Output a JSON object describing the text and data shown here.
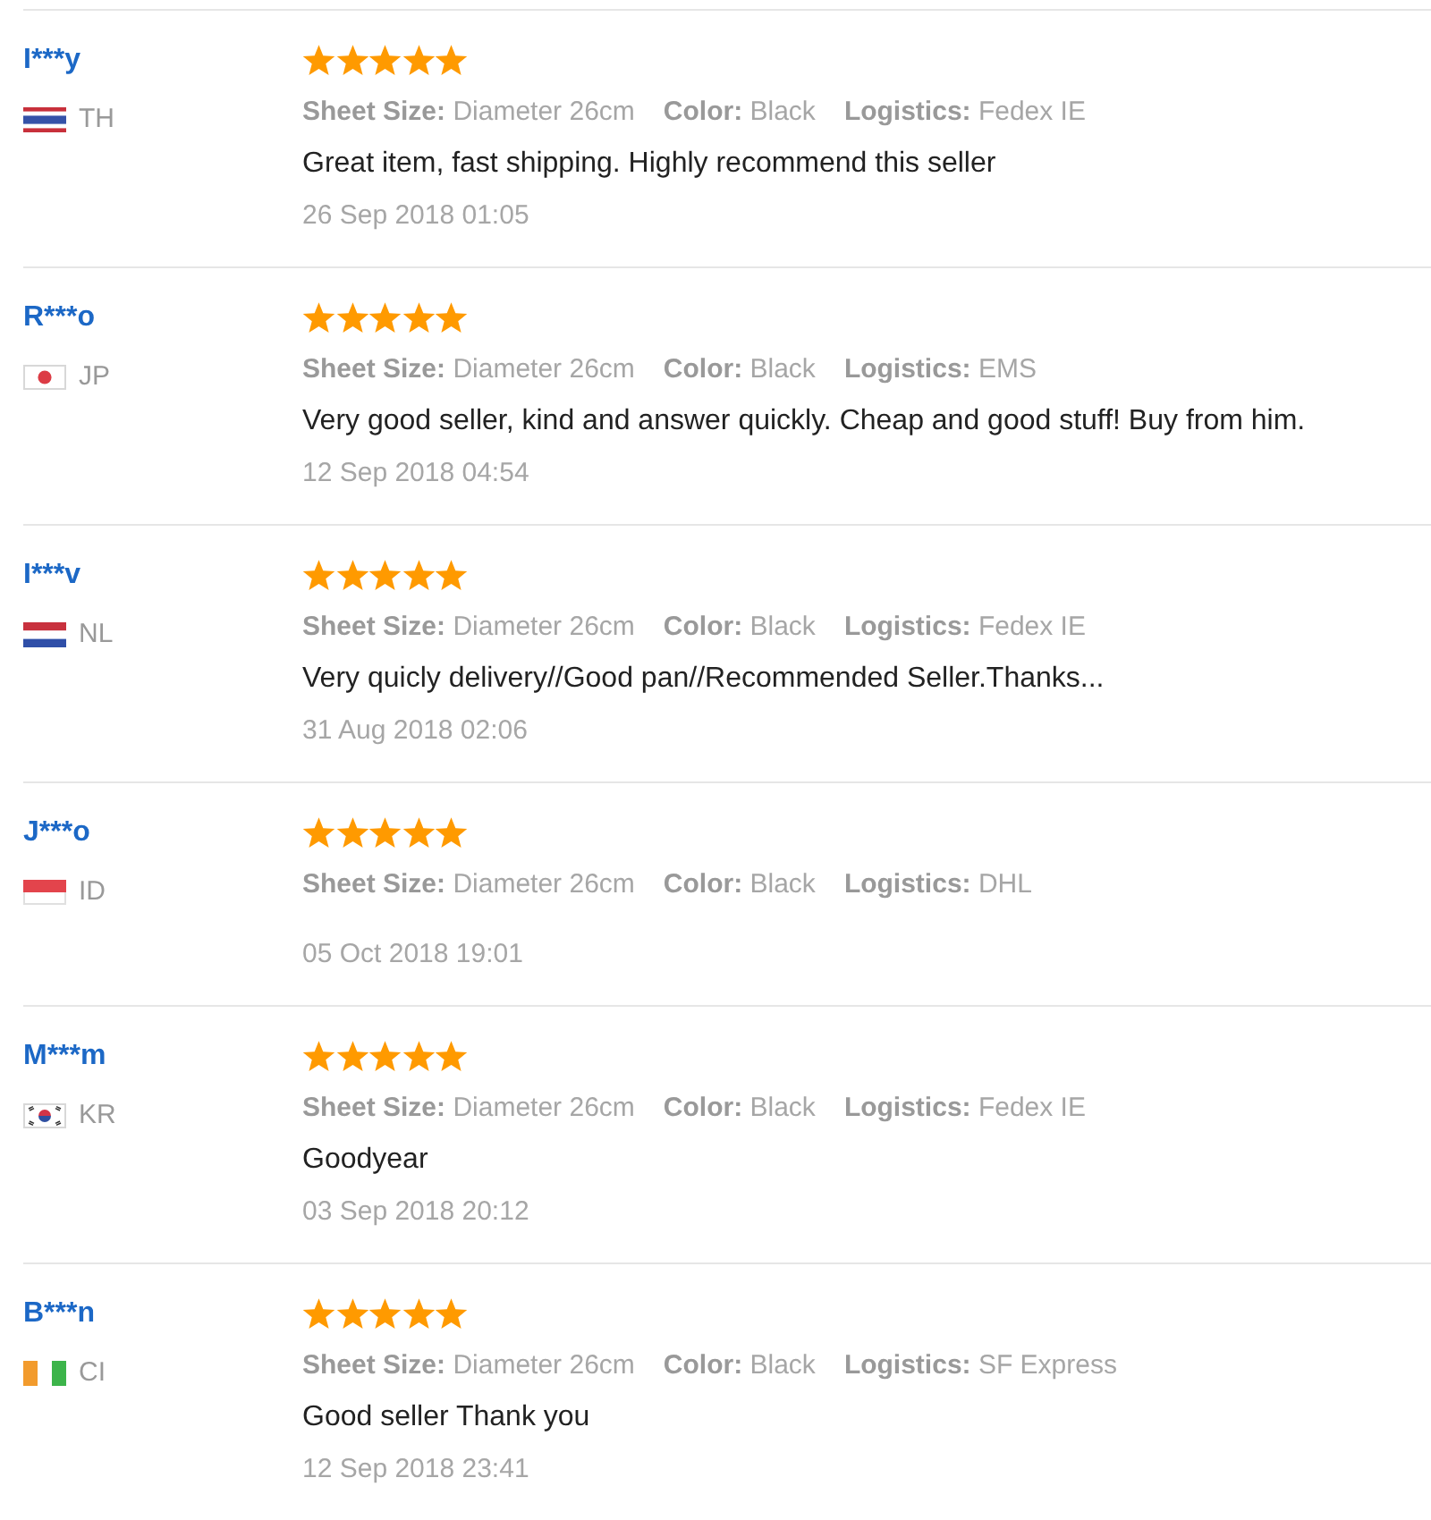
{
  "reviews": [
    {
      "user": "I***y",
      "flag": {
        "kind": "thailand"
      },
      "country": "TH",
      "stars": 5,
      "attributes": [
        {
          "label": "Sheet Size:",
          "value": "Diameter 26cm"
        },
        {
          "label": "Color:",
          "value": "Black"
        },
        {
          "label": "Logistics:",
          "value": "Fedex IE"
        }
      ],
      "comment": "Great item, fast shipping. Highly recommend this seller",
      "date": "26 Sep 2018 01:05"
    },
    {
      "user": "R***o",
      "flag": {
        "kind": "japan"
      },
      "country": "JP",
      "stars": 5,
      "attributes": [
        {
          "label": "Sheet Size:",
          "value": "Diameter 26cm"
        },
        {
          "label": "Color:",
          "value": "Black"
        },
        {
          "label": "Logistics:",
          "value": "EMS"
        }
      ],
      "comment": "Very good seller, kind and answer quickly. Cheap and good stuff! Buy from him.",
      "date": "12 Sep 2018 04:54"
    },
    {
      "user": "I***v",
      "flag": {
        "kind": "netherlands"
      },
      "country": "NL",
      "stars": 5,
      "attributes": [
        {
          "label": "Sheet Size:",
          "value": "Diameter 26cm"
        },
        {
          "label": "Color:",
          "value": "Black"
        },
        {
          "label": "Logistics:",
          "value": "Fedex IE"
        }
      ],
      "comment": "Very quicly delivery//Good pan//Recommended Seller.Thanks...",
      "date": "31 Aug 2018 02:06"
    },
    {
      "user": "J***o",
      "flag": {
        "kind": "indonesia"
      },
      "country": "ID",
      "stars": 5,
      "attributes": [
        {
          "label": "Sheet Size:",
          "value": "Diameter 26cm"
        },
        {
          "label": "Color:",
          "value": "Black"
        },
        {
          "label": "Logistics:",
          "value": "DHL"
        }
      ],
      "date": "05 Oct 2018 19:01"
    },
    {
      "user": "M***m",
      "flag": {
        "kind": "korea"
      },
      "country": "KR",
      "stars": 5,
      "attributes": [
        {
          "label": "Sheet Size:",
          "value": "Diameter 26cm"
        },
        {
          "label": "Color:",
          "value": "Black"
        },
        {
          "label": "Logistics:",
          "value": "Fedex IE"
        }
      ],
      "comment": "Goodyear",
      "date": "03 Sep 2018 20:12"
    },
    {
      "user": "B***n",
      "flag": {
        "kind": "ivorycoast"
      },
      "country": "CI",
      "stars": 5,
      "attributes": [
        {
          "label": "Sheet Size:",
          "value": "Diameter 26cm"
        },
        {
          "label": "Color:",
          "value": "Black"
        },
        {
          "label": "Logistics:",
          "value": "SF Express"
        }
      ],
      "comment": "Good seller Thank you",
      "date": "12 Sep 2018 23:41"
    }
  ]
}
